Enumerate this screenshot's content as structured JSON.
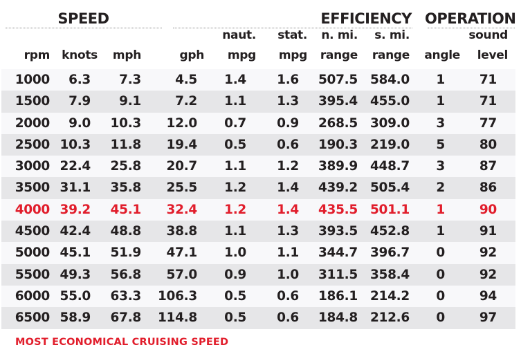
{
  "chart_data": {
    "type": "table",
    "title": "",
    "groups": [
      {
        "name": "SPEED",
        "columns": [
          "rpm",
          "knots",
          "mph"
        ]
      },
      {
        "name": "EFFICIENCY",
        "columns": [
          "gph",
          "naut. mpg",
          "stat. mpg",
          "n. mi. range",
          "s. mi. range"
        ]
      },
      {
        "name": "OPERATION",
        "columns": [
          "angle",
          "sound level"
        ]
      }
    ],
    "headers": [
      {
        "key": "rpm",
        "line1": "",
        "line2": "rpm"
      },
      {
        "key": "knots",
        "line1": "",
        "line2": "knots"
      },
      {
        "key": "mph",
        "line1": "",
        "line2": "mph"
      },
      {
        "key": "gph",
        "line1": "",
        "line2": "gph"
      },
      {
        "key": "naut_mpg",
        "line1": "naut.",
        "line2": "mpg"
      },
      {
        "key": "stat_mpg",
        "line1": "stat.",
        "line2": "mpg"
      },
      {
        "key": "nmi_range",
        "line1": "n. mi.",
        "line2": "range"
      },
      {
        "key": "smi_range",
        "line1": "s. mi.",
        "line2": "range"
      },
      {
        "key": "angle",
        "line1": "",
        "line2": "angle"
      },
      {
        "key": "sound",
        "line1": "sound",
        "line2": "level"
      }
    ],
    "rows": [
      [
        "1000",
        "6.3",
        "7.3",
        "4.5",
        "1.4",
        "1.6",
        "507.5",
        "584.0",
        "1",
        "71"
      ],
      [
        "1500",
        "7.9",
        "9.1",
        "7.2",
        "1.1",
        "1.3",
        "395.4",
        "455.0",
        "1",
        "71"
      ],
      [
        "2000",
        "9.0",
        "10.3",
        "12.0",
        "0.7",
        "0.9",
        "268.5",
        "309.0",
        "3",
        "77"
      ],
      [
        "2500",
        "10.3",
        "11.8",
        "19.4",
        "0.5",
        "0.6",
        "190.3",
        "219.0",
        "5",
        "80"
      ],
      [
        "3000",
        "22.4",
        "25.8",
        "20.7",
        "1.1",
        "1.2",
        "389.9",
        "448.7",
        "3",
        "87"
      ],
      [
        "3500",
        "31.1",
        "35.8",
        "25.5",
        "1.2",
        "1.4",
        "439.2",
        "505.4",
        "2",
        "86"
      ],
      [
        "4000",
        "39.2",
        "45.1",
        "32.4",
        "1.2",
        "1.4",
        "435.5",
        "501.1",
        "1",
        "90"
      ],
      [
        "4500",
        "42.4",
        "48.8",
        "38.8",
        "1.1",
        "1.3",
        "393.5",
        "452.8",
        "1",
        "91"
      ],
      [
        "5000",
        "45.1",
        "51.9",
        "47.1",
        "1.0",
        "1.1",
        "344.7",
        "396.7",
        "0",
        "92"
      ],
      [
        "5500",
        "49.3",
        "56.8",
        "57.0",
        "0.9",
        "1.0",
        "311.5",
        "358.4",
        "0",
        "92"
      ],
      [
        "6000",
        "55.0",
        "63.3",
        "106.3",
        "0.5",
        "0.6",
        "186.1",
        "214.2",
        "0",
        "94"
      ],
      [
        "6500",
        "58.9",
        "67.8",
        "114.8",
        "0.5",
        "0.6",
        "184.8",
        "212.6",
        "0",
        "97"
      ]
    ],
    "highlight_row_rpm": "4000",
    "footnote": "MOST ECONOMICAL CRUISING SPEED"
  },
  "colors": {
    "text": "#231f20",
    "highlight": "#e11d2b",
    "row_light": "#f8f8fa",
    "row_dark": "#e6e6e8",
    "rule": "#8a8a8a"
  }
}
